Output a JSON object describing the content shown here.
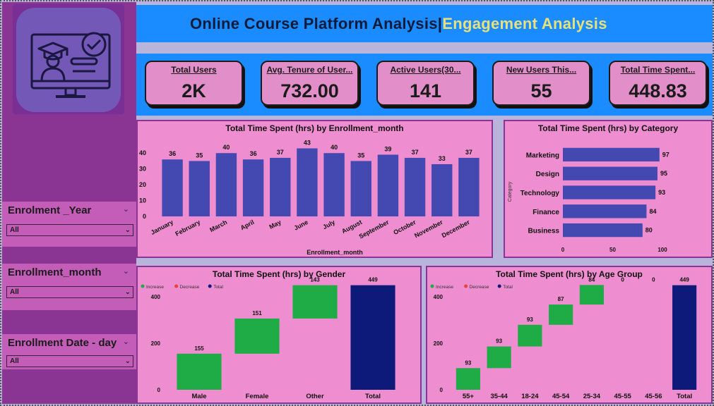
{
  "header": {
    "title_main": "Online Course Platform Analysis|",
    "title_accent": "Engagement Analysis"
  },
  "colors": {
    "sidebar": "#8a3594",
    "header": "#1a8cff",
    "panel": "#ee8dcf",
    "bar": "#4349b0",
    "increase": "#1fab46",
    "decrease": "#e8413a",
    "total": "#0d1a7a"
  },
  "logo": {
    "icon": "online-course-graduate-icon"
  },
  "slicers": [
    {
      "label": "Enrolment _Year",
      "value": "All"
    },
    {
      "label": "Enrollment_month",
      "value": "All"
    },
    {
      "label": "Enrollment Date - day",
      "value": "All"
    }
  ],
  "kpis": [
    {
      "label": "Total Users",
      "value": "2K"
    },
    {
      "label": "Avg. Tenure of User...",
      "value": "732.00"
    },
    {
      "label": "Active Users(30...",
      "value": "141"
    },
    {
      "label": "New Users This...",
      "value": "55"
    },
    {
      "label": "Total Time Spent...",
      "value": "448.83"
    }
  ],
  "chart_data": [
    {
      "type": "bar",
      "title": "Total Time Spent (hrs) by Enrollment_month",
      "xlabel": "Enrollment_month",
      "ylabel": "",
      "categories": [
        "January",
        "February",
        "March",
        "April",
        "May",
        "June",
        "July",
        "August",
        "September",
        "October",
        "November",
        "December"
      ],
      "values": [
        36,
        35,
        40,
        36,
        37,
        43,
        40,
        35,
        39,
        37,
        33,
        37
      ],
      "ylim": [
        0,
        45
      ],
      "yticks": [
        0,
        10,
        20,
        30,
        40
      ]
    },
    {
      "type": "bar",
      "orientation": "horizontal",
      "title": "Total Time Spent (hrs) by Category",
      "ylabel": "Category",
      "categories": [
        "Marketing",
        "Design",
        "Technology",
        "Finance",
        "Business"
      ],
      "values": [
        97,
        95,
        93,
        84,
        80
      ],
      "xlim": [
        0,
        100
      ],
      "xticks": [
        0,
        50,
        100
      ]
    },
    {
      "type": "waterfall",
      "title": "Total Time Spent (hrs) by Gender",
      "legend": [
        "Increase",
        "Decrease",
        "Total"
      ],
      "categories": [
        "Male",
        "Female",
        "Other",
        "Total"
      ],
      "values": [
        155,
        151,
        143,
        449
      ],
      "kinds": [
        "increase",
        "increase",
        "increase",
        "total"
      ],
      "ylim": [
        0,
        460
      ],
      "yticks": [
        0,
        200,
        400
      ]
    },
    {
      "type": "waterfall",
      "title": "Total Time Spent (hrs) by Age Group",
      "legend": [
        "Increase",
        "Decrease",
        "Total"
      ],
      "categories": [
        "55+",
        "35-44",
        "18-24",
        "45-54",
        "25-34",
        "45-55",
        "45-56",
        "Total"
      ],
      "values": [
        93,
        93,
        93,
        87,
        84,
        0,
        0,
        449
      ],
      "kinds": [
        "increase",
        "increase",
        "increase",
        "increase",
        "increase",
        "increase",
        "increase",
        "total"
      ],
      "ylim": [
        0,
        460
      ],
      "yticks": [
        0,
        200,
        400
      ]
    }
  ]
}
